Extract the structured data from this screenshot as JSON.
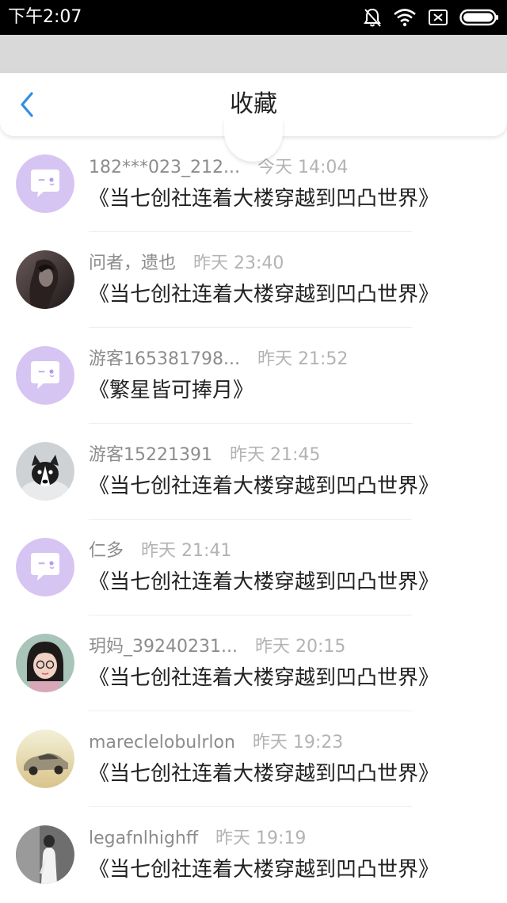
{
  "status": {
    "time": "下午2:07",
    "icons": [
      "bell-off-icon",
      "wifi-icon",
      "sim-off-icon",
      "battery-icon"
    ]
  },
  "header": {
    "title": "收藏",
    "back_icon": "chevron-left-icon"
  },
  "colors": {
    "accent": "#2f8ee5",
    "default_avatar": "#d6c4f2",
    "title": "#222222",
    "username": "#8c8c8c",
    "timestamp": "#b3b3b3"
  },
  "items": [
    {
      "user": "182***023_212...",
      "time": "今天 14:04",
      "book": "《当七创社连着大楼穿越到凹凸世界》",
      "avatar": "default"
    },
    {
      "user": "问者，遗也",
      "time": "昨天 23:40",
      "book": "《当七创社连着大楼穿越到凹凸世界》",
      "avatar": "dark-portrait"
    },
    {
      "user": "游客165381798...",
      "time": "昨天 21:52",
      "book": "《繁星皆可捧月》",
      "avatar": "default"
    },
    {
      "user": "游客15221391",
      "time": "昨天 21:45",
      "book": "《当七创社连着大楼穿越到凹凸世界》",
      "avatar": "dog"
    },
    {
      "user": "仁多",
      "time": "昨天 21:41",
      "book": "《当七创社连着大楼穿越到凹凸世界》",
      "avatar": "default"
    },
    {
      "user": "玥妈_39240231...",
      "time": "昨天 20:15",
      "book": "《当七创社连着大楼穿越到凹凸世界》",
      "avatar": "girl"
    },
    {
      "user": "mareclelobulrlon",
      "time": "昨天 19:23",
      "book": "《当七创社连着大楼穿越到凹凸世界》",
      "avatar": "car"
    },
    {
      "user": "legafnlhighff",
      "time": "昨天 19:19",
      "book": "《当七创社连着大楼穿越到凹凸世界》",
      "avatar": "person-bw"
    }
  ]
}
